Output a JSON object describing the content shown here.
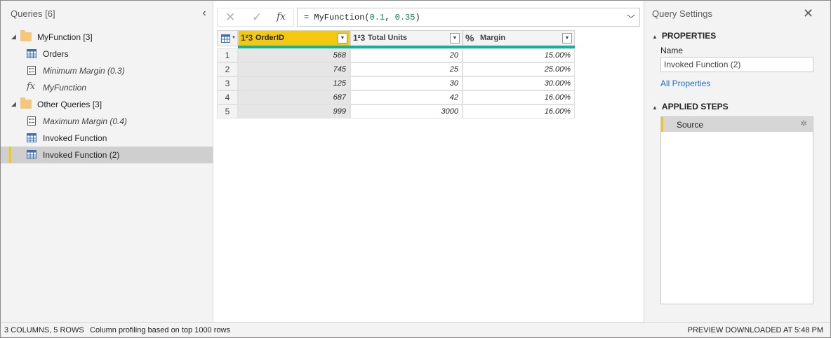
{
  "queries_pane": {
    "title": "Queries [6]",
    "groups": [
      {
        "label": "MyFunction [3]",
        "items": [
          {
            "label": "Orders",
            "type": "table",
            "italic": false
          },
          {
            "label": "Minimum Margin (0.3)",
            "type": "parameter",
            "italic": true
          },
          {
            "label": "MyFunction",
            "type": "function",
            "italic": true
          }
        ]
      },
      {
        "label": "Other Queries [3]",
        "items": [
          {
            "label": "Maximum Margin (0.4)",
            "type": "parameter",
            "italic": true
          },
          {
            "label": "Invoked Function",
            "type": "table",
            "italic": false
          },
          {
            "label": "Invoked Function (2)",
            "type": "table",
            "italic": false,
            "selected": true
          }
        ]
      }
    ]
  },
  "formula_bar": {
    "prefix": "= MyFunction(",
    "arg1": "0.1",
    "sep": ", ",
    "arg2": "0.35",
    "suffix": ")",
    "fx_label": "fx"
  },
  "table": {
    "columns": [
      {
        "type_icon": "1²3",
        "name": "OrderID",
        "active": true
      },
      {
        "type_icon": "1²3",
        "name": "Total Units",
        "active": false
      },
      {
        "type_icon": "%",
        "name": "Margin",
        "active": false
      }
    ],
    "rows": [
      {
        "num": "1",
        "cells": [
          "568",
          "20",
          "15.00%"
        ]
      },
      {
        "num": "2",
        "cells": [
          "745",
          "25",
          "25.00%"
        ]
      },
      {
        "num": "3",
        "cells": [
          "125",
          "30",
          "30.00%"
        ]
      },
      {
        "num": "4",
        "cells": [
          "687",
          "42",
          "16.00%"
        ]
      },
      {
        "num": "5",
        "cells": [
          "999",
          "3000",
          "16.00%"
        ]
      }
    ]
  },
  "settings": {
    "title": "Query Settings",
    "properties_header": "PROPERTIES",
    "name_label": "Name",
    "name_value": "Invoked Function (2)",
    "all_properties": "All Properties",
    "applied_steps_header": "APPLIED STEPS",
    "steps": [
      "Source"
    ]
  },
  "status_bar": {
    "summary": "3 COLUMNS, 5 ROWS",
    "profiling": "Column profiling based on top 1000 rows",
    "preview": "PREVIEW DOWNLOADED AT 5:48 PM"
  },
  "colors": {
    "accent": "#f2c811",
    "quality": "#13b19d",
    "link": "#1f6fc5"
  }
}
